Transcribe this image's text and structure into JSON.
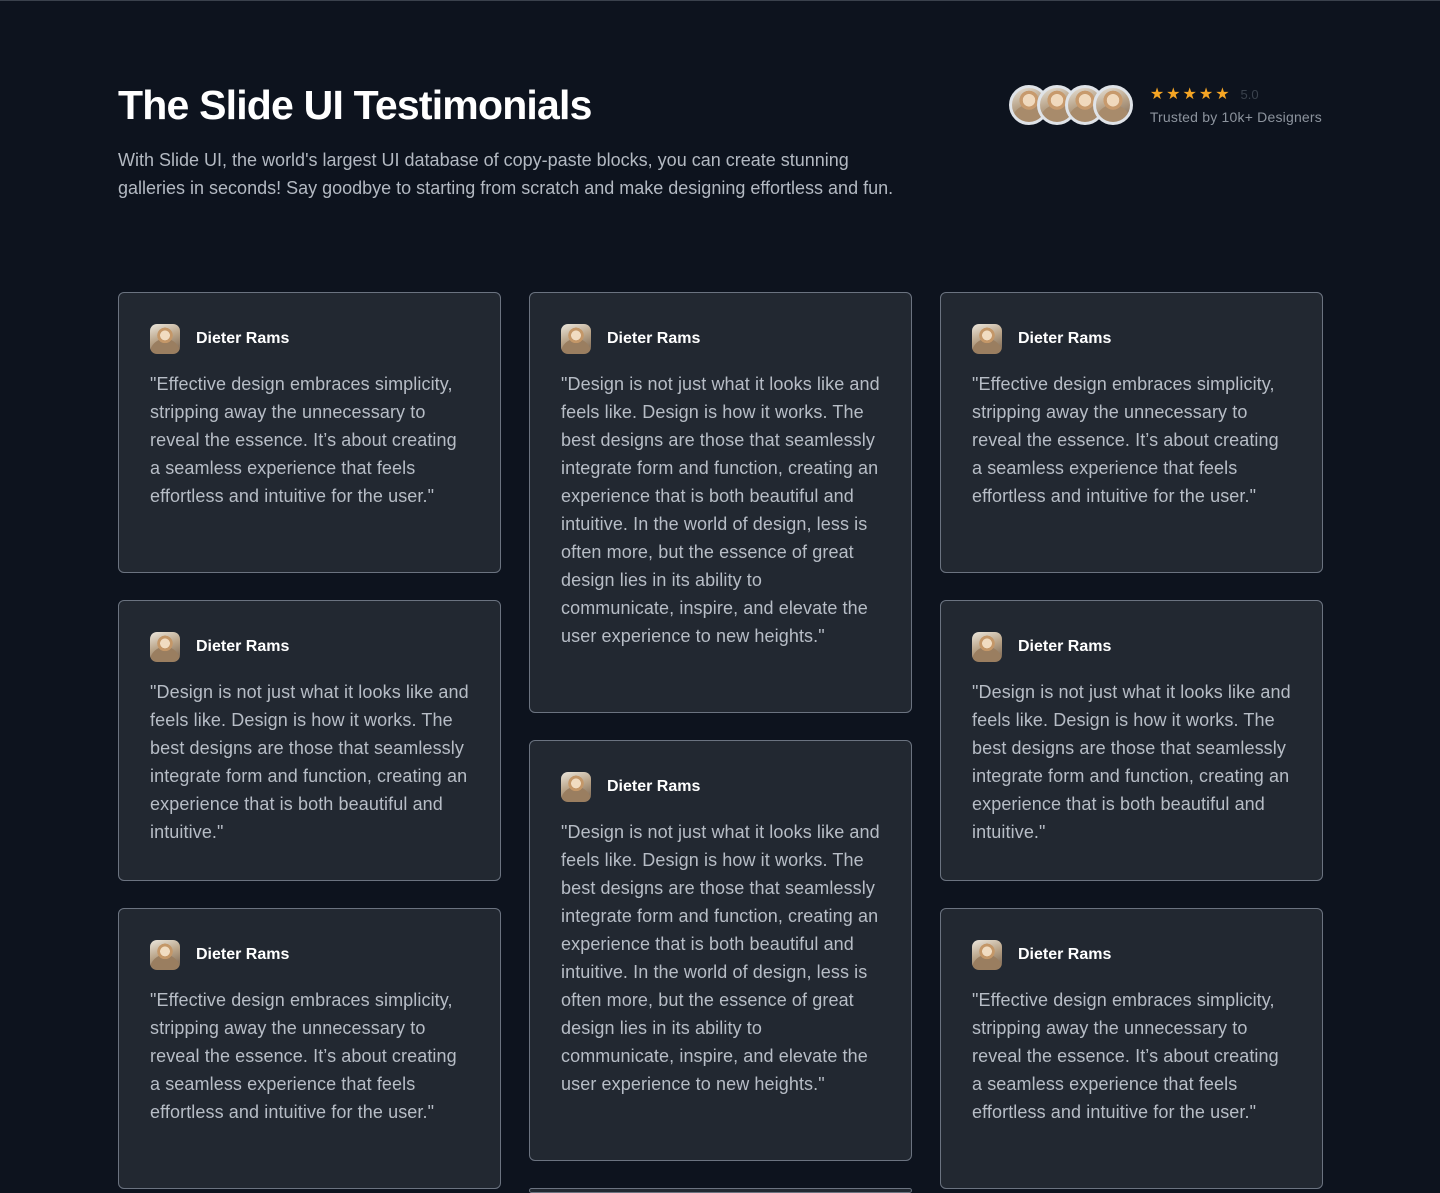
{
  "header": {
    "title": "The Slide UI Testimonials",
    "subtitle": "With Slide UI, the world's largest UI database of copy-paste blocks, you can create stunning galleries in seconds! Say goodbye to starting from scratch and make designing effortless and fun.",
    "rating_score": "5.0",
    "rating_stars": 5,
    "trusted_text": "Trusted by 10k+ Designers",
    "star_glyph": "★"
  },
  "colors": {
    "background": "#0d131e",
    "card": "#222831",
    "card_border": "#6b7380",
    "star": "#f5a524"
  },
  "testimonials": [
    {
      "name": "Dieter Rams",
      "quote": "\"Effective design embraces simplicity, stripping away the unnecessary to reveal the essence. It’s about creating a seamless experience that feels effortless and intuitive for the user.\""
    },
    {
      "name": "Dieter Rams",
      "quote": "\"Design is not just what it looks like and feels like. Design is how it works. The best designs are those that seamlessly integrate form and function, creating an experience that is both beautiful and intuitive. In the world of design, less is often more, but the essence of great design lies in its ability to communicate, inspire, and elevate the user experience to new heights.\""
    },
    {
      "name": "Dieter Rams",
      "quote": "\"Effective design embraces simplicity, stripping away the unnecessary to reveal the essence. It’s about creating a seamless experience that feels effortless and intuitive for the user.\""
    },
    {
      "name": "Dieter Rams",
      "quote": "\"Design is not just what it looks like and feels like. Design is how it works. The best designs are those that seamlessly integrate form and function, creating an experience that is both beautiful and intuitive.\""
    },
    {
      "name": "Dieter Rams",
      "quote": "\"Design is not just what it looks like and feels like. Design is how it works. The best designs are those that seamlessly integrate form and function, creating an experience that is both beautiful and intuitive. In the world of design, less is often more, but the essence of great design lies in its ability to communicate, inspire, and elevate the user experience to new heights.\""
    },
    {
      "name": "Dieter Rams",
      "quote": "\"Design is not just what it looks like and feels like. Design is how it works. The best designs are those that seamlessly integrate form and function, creating an experience that is both beautiful and intuitive.\""
    },
    {
      "name": "Dieter Rams",
      "quote": "\"Effective design embraces simplicity, stripping away the unnecessary to reveal the essence. It’s about creating a seamless experience that feels effortless and intuitive for the user.\""
    },
    {
      "name": "Dieter Rams",
      "quote": "\"Effective design embraces simplicity, stripping away the unnecessary to reveal the essence. It’s about creating a seamless experience that feels effortless and intuitive for the user.\""
    }
  ]
}
